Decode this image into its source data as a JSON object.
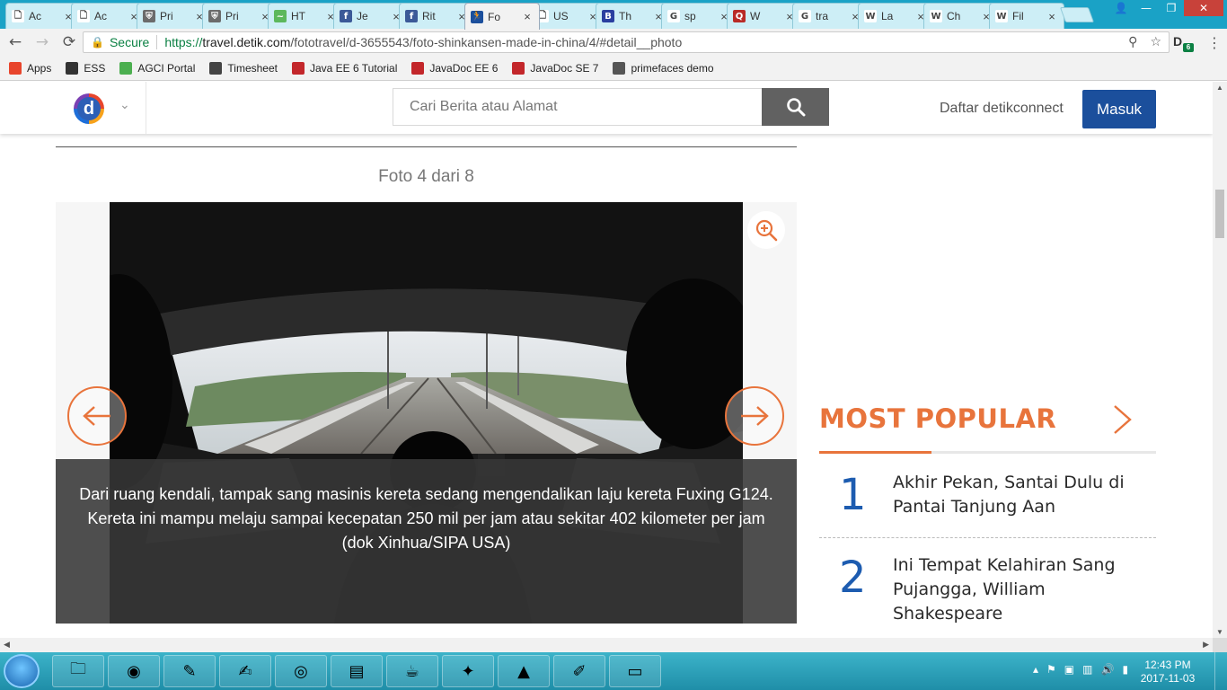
{
  "browser": {
    "tabs": [
      {
        "label": "Ac",
        "fav": "doc-icon",
        "favColor": "#ffffff",
        "favGlyph": "🗋"
      },
      {
        "label": "Ac",
        "fav": "doc-icon",
        "favColor": "#ffffff",
        "favGlyph": "🗋"
      },
      {
        "label": "Pri",
        "fav": "shield-icon",
        "favColor": "#6b6b6b",
        "favGlyph": "⛨"
      },
      {
        "label": "Pri",
        "fav": "shield-icon",
        "favColor": "#6b6b6b",
        "favGlyph": "⛨"
      },
      {
        "label": "HT",
        "fav": "chart-icon",
        "favColor": "#5cb85c",
        "favGlyph": "~"
      },
      {
        "label": "Je",
        "fav": "facebook-icon",
        "favColor": "#3b5998",
        "favGlyph": "f"
      },
      {
        "label": "Rit",
        "fav": "facebook-icon",
        "favColor": "#3b5998",
        "favGlyph": "f"
      },
      {
        "label": "Fo",
        "fav": "runner-icon",
        "favColor": "#1b4f9c",
        "favGlyph": "🏃"
      },
      {
        "label": "US",
        "fav": "doc-icon",
        "favColor": "#ffffff",
        "favGlyph": "🗋"
      },
      {
        "label": "Th",
        "fav": "b-icon",
        "favColor": "#2a3fa0",
        "favGlyph": "B"
      },
      {
        "label": "sp",
        "fav": "google-icon",
        "favColor": "#ffffff",
        "favGlyph": "G"
      },
      {
        "label": "W",
        "fav": "quora-icon",
        "favColor": "#b92b27",
        "favGlyph": "Q"
      },
      {
        "label": "tra",
        "fav": "google-icon",
        "favColor": "#ffffff",
        "favGlyph": "G"
      },
      {
        "label": "La",
        "fav": "wikipedia-icon",
        "favColor": "#ffffff",
        "favGlyph": "W"
      },
      {
        "label": "Ch",
        "fav": "wikipedia-icon",
        "favColor": "#ffffff",
        "favGlyph": "W"
      },
      {
        "label": "Fil",
        "fav": "wikipedia-icon",
        "favColor": "#ffffff",
        "favGlyph": "W"
      }
    ],
    "active_tab_index": 7,
    "secure_label": "Secure",
    "url_scheme": "https://",
    "url_host": "travel.detik.com",
    "url_path": "/fototravel/d-3655543/foto-shinkansen-made-in-china/4/#detail__photo",
    "extension_badge": "6",
    "bookmarks": [
      {
        "label": "Apps",
        "icon": "apps-grid-icon",
        "color": "#e8452c"
      },
      {
        "label": "ESS",
        "icon": "ess-icon",
        "color": "#333333"
      },
      {
        "label": "AGCI Portal",
        "icon": "agci-icon",
        "color": "#4caf50"
      },
      {
        "label": "Timesheet",
        "icon": "timesheet-icon",
        "color": "#444444"
      },
      {
        "label": "Java EE 6 Tutorial",
        "icon": "oracle-icon",
        "color": "#c3272b"
      },
      {
        "label": "JavaDoc EE 6",
        "icon": "oracle-icon",
        "color": "#c3272b"
      },
      {
        "label": "JavaDoc SE 7",
        "icon": "oracle-icon",
        "color": "#c3272b"
      },
      {
        "label": "primefaces demo",
        "icon": "shield-icon",
        "color": "#555555"
      }
    ]
  },
  "site": {
    "logo_letter": "d",
    "search_placeholder": "Cari Berita atau Alamat",
    "register_label": "Daftar detikconnect",
    "login_label": "Masuk",
    "accent": "#e8743c",
    "brand_blue": "#1b4f9c"
  },
  "gallery": {
    "counter": "Foto 4 dari 8",
    "caption": "Dari ruang kendali, tampak sang masinis kereta sedang mengendalikan laju kereta Fuxing G124. Kereta ini mampu melaju sampai kecepatan 250 mil per jam atau sekitar 402 kilometer per jam (dok Xinhua/SIPA USA)"
  },
  "most_popular": {
    "title": "MOST POPULAR",
    "items": [
      {
        "rank": "1",
        "title": "Akhir Pekan, Santai Dulu di Pantai Tanjung Aan"
      },
      {
        "rank": "2",
        "title": "Ini Tempat Kelahiran Sang Pujangga, William Shakespeare"
      }
    ]
  },
  "taskbar": {
    "apps": [
      {
        "name": "file-explorer-icon",
        "glyph": "🗀"
      },
      {
        "name": "firefox-icon",
        "glyph": "◉"
      },
      {
        "name": "notepad-icon",
        "glyph": "✎"
      },
      {
        "name": "notepadpp-icon",
        "glyph": "✍"
      },
      {
        "name": "chrome-icon",
        "glyph": "◎"
      },
      {
        "name": "sticky-notes-icon",
        "glyph": "▤"
      },
      {
        "name": "java-ee-ide-icon",
        "glyph": "☕"
      },
      {
        "name": "acrobat-icon",
        "glyph": "✦"
      },
      {
        "name": "vlc-icon",
        "glyph": "▲"
      },
      {
        "name": "paint-icon",
        "glyph": "✐"
      },
      {
        "name": "cmd-icon",
        "glyph": "▭"
      }
    ],
    "time": "12:43 PM",
    "date": "2017-11-03"
  }
}
